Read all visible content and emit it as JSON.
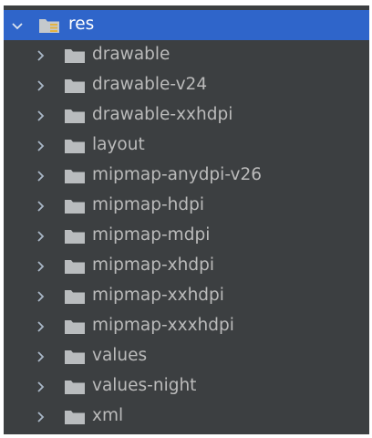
{
  "colors": {
    "background": "#3c3f41",
    "selection": "#2f65ca",
    "text": "#bbbbbb",
    "selected_text": "#ffffff",
    "chevron": "#a9b7c6",
    "folder": "#b9bcbe"
  },
  "tree": {
    "root": {
      "label": "res",
      "expanded": true,
      "icon": "resource-folder-icon",
      "chevron_icon": "chevron-down-icon"
    },
    "children": [
      {
        "label": "drawable",
        "icon": "folder-icon",
        "chevron_icon": "chevron-right-icon"
      },
      {
        "label": "drawable-v24",
        "icon": "folder-icon",
        "chevron_icon": "chevron-right-icon"
      },
      {
        "label": "drawable-xxhdpi",
        "icon": "folder-icon",
        "chevron_icon": "chevron-right-icon"
      },
      {
        "label": "layout",
        "icon": "folder-icon",
        "chevron_icon": "chevron-right-icon"
      },
      {
        "label": "mipmap-anydpi-v26",
        "icon": "folder-icon",
        "chevron_icon": "chevron-right-icon"
      },
      {
        "label": "mipmap-hdpi",
        "icon": "folder-icon",
        "chevron_icon": "chevron-right-icon"
      },
      {
        "label": "mipmap-mdpi",
        "icon": "folder-icon",
        "chevron_icon": "chevron-right-icon"
      },
      {
        "label": "mipmap-xhdpi",
        "icon": "folder-icon",
        "chevron_icon": "chevron-right-icon"
      },
      {
        "label": "mipmap-xxhdpi",
        "icon": "folder-icon",
        "chevron_icon": "chevron-right-icon"
      },
      {
        "label": "mipmap-xxxhdpi",
        "icon": "folder-icon",
        "chevron_icon": "chevron-right-icon"
      },
      {
        "label": "values",
        "icon": "folder-icon",
        "chevron_icon": "chevron-right-icon"
      },
      {
        "label": "values-night",
        "icon": "folder-icon",
        "chevron_icon": "chevron-right-icon"
      },
      {
        "label": "xml",
        "icon": "folder-icon",
        "chevron_icon": "chevron-right-icon"
      }
    ]
  }
}
